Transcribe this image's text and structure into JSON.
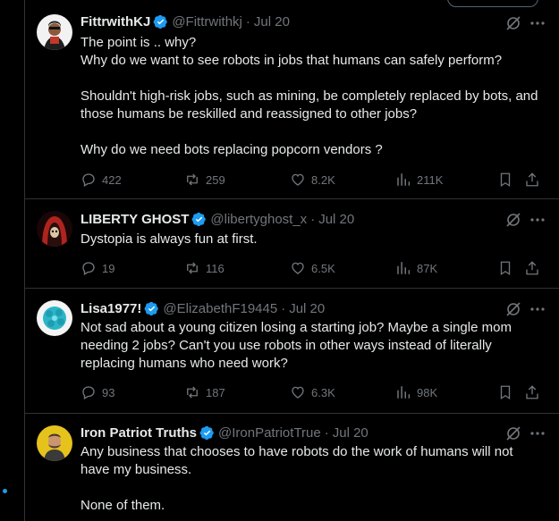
{
  "colors": {
    "background": "#000000",
    "text": "#e7e9ea",
    "muted": "#71767b",
    "verified": "#1d9bf0",
    "divider": "#2f3336"
  },
  "tweets": [
    {
      "name": "FittrwithKJ",
      "handle": "@Fittrwithkj",
      "sep": "·",
      "time": "Jul 20",
      "paragraphs": [
        "The point is .. why?\nWhy do we want to see robots in jobs that humans can safely perform?",
        "Shouldn't high-risk jobs, such as mining, be completely replaced by bots, and those humans be reskilled and reassigned to other jobs?",
        "Why do we need bots replacing popcorn vendors ?"
      ],
      "replies": "422",
      "reposts": "259",
      "likes": "8.2K",
      "views": "211K"
    },
    {
      "name": "LIBERTY GHOST",
      "handle": "@libertyghost_x",
      "sep": "·",
      "time": "Jul 20",
      "paragraphs": [
        "Dystopia is always fun at first."
      ],
      "replies": "19",
      "reposts": "116",
      "likes": "6.5K",
      "views": "87K"
    },
    {
      "name": "Lisa1977!",
      "handle": "@ElizabethF19445",
      "sep": "·",
      "time": "Jul 20",
      "paragraphs": [
        "Not sad about a young citizen losing a starting job? Maybe a single mom needing 2 jobs? Can't you use robots in other ways instead of literally replacing humans who need work?"
      ],
      "replies": "93",
      "reposts": "187",
      "likes": "6.3K",
      "views": "98K"
    },
    {
      "name": "Iron Patriot Truths",
      "handle": "@IronPatriotTrue",
      "sep": "·",
      "time": "Jul 20",
      "paragraphs": [
        "Any business that chooses to have robots do the work of humans will not have my business.",
        "None of them."
      ]
    }
  ],
  "icons": [
    "verified-badge-icon",
    "grok-icon",
    "more-icon",
    "reply-icon",
    "repost-icon",
    "like-icon",
    "views-icon",
    "bookmark-icon",
    "share-icon"
  ]
}
